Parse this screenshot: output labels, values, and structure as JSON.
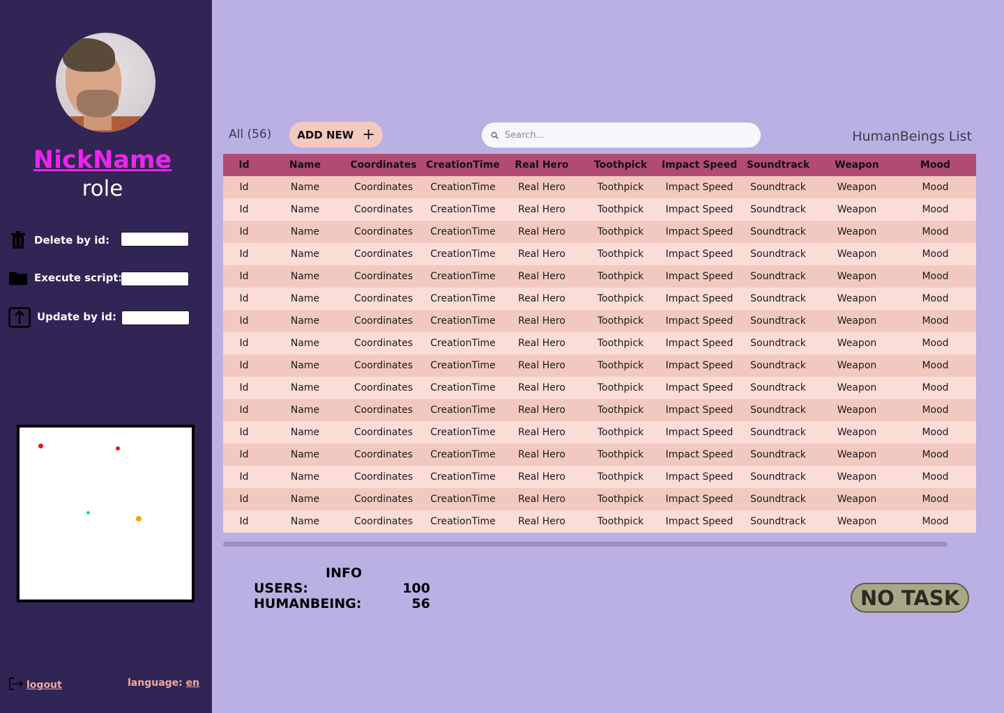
{
  "profile": {
    "nickname": "NickName",
    "role": "role"
  },
  "actions": [
    {
      "label": "Delete by id:",
      "icon": "trash-icon",
      "value": ""
    },
    {
      "label": "Execute script:",
      "icon": "folder-icon",
      "value": ""
    },
    {
      "label": "Update by id:",
      "icon": "upload-icon",
      "value": ""
    }
  ],
  "map": {
    "dots": [
      {
        "color": "#e8151c"
      },
      {
        "color": "#e8151c"
      },
      {
        "color": "#19e27a"
      },
      {
        "color": "#f6a20f"
      }
    ]
  },
  "footer": {
    "logout": "logout",
    "language_label": "language:",
    "language_value": "en"
  },
  "toolbar": {
    "all_label": "All (56)",
    "add_new": "ADD NEW",
    "add_icon": "plus-icon",
    "search_placeholder": "Search...",
    "list_title": "HumanBeings List"
  },
  "table": {
    "columns": [
      "Id",
      "Name",
      "Coordinates",
      "CreationTime",
      "Real Hero",
      "Toothpick",
      "Impact Speed",
      "Soundtrack",
      "Weapon",
      "Mood"
    ],
    "rows": [
      [
        "Id",
        "Name",
        "Coordinates",
        "CreationTime",
        "Real Hero",
        "Toothpick",
        "Impact Speed",
        "Soundtrack",
        "Weapon",
        "Mood"
      ],
      [
        "Id",
        "Name",
        "Coordinates",
        "CreationTime",
        "Real Hero",
        "Toothpick",
        "Impact Speed",
        "Soundtrack",
        "Weapon",
        "Mood"
      ],
      [
        "Id",
        "Name",
        "Coordinates",
        "CreationTime",
        "Real Hero",
        "Toothpick",
        "Impact Speed",
        "Soundtrack",
        "Weapon",
        "Mood"
      ],
      [
        "Id",
        "Name",
        "Coordinates",
        "CreationTime",
        "Real Hero",
        "Toothpick",
        "Impact Speed",
        "Soundtrack",
        "Weapon",
        "Mood"
      ],
      [
        "Id",
        "Name",
        "Coordinates",
        "CreationTime",
        "Real Hero",
        "Toothpick",
        "Impact Speed",
        "Soundtrack",
        "Weapon",
        "Mood"
      ],
      [
        "Id",
        "Name",
        "Coordinates",
        "CreationTime",
        "Real Hero",
        "Toothpick",
        "Impact Speed",
        "Soundtrack",
        "Weapon",
        "Mood"
      ],
      [
        "Id",
        "Name",
        "Coordinates",
        "CreationTime",
        "Real Hero",
        "Toothpick",
        "Impact Speed",
        "Soundtrack",
        "Weapon",
        "Mood"
      ],
      [
        "Id",
        "Name",
        "Coordinates",
        "CreationTime",
        "Real Hero",
        "Toothpick",
        "Impact Speed",
        "Soundtrack",
        "Weapon",
        "Mood"
      ],
      [
        "Id",
        "Name",
        "Coordinates",
        "CreationTime",
        "Real Hero",
        "Toothpick",
        "Impact Speed",
        "Soundtrack",
        "Weapon",
        "Mood"
      ],
      [
        "Id",
        "Name",
        "Coordinates",
        "CreationTime",
        "Real Hero",
        "Toothpick",
        "Impact Speed",
        "Soundtrack",
        "Weapon",
        "Mood"
      ],
      [
        "Id",
        "Name",
        "Coordinates",
        "CreationTime",
        "Real Hero",
        "Toothpick",
        "Impact Speed",
        "Soundtrack",
        "Weapon",
        "Mood"
      ],
      [
        "Id",
        "Name",
        "Coordinates",
        "CreationTime",
        "Real Hero",
        "Toothpick",
        "Impact Speed",
        "Soundtrack",
        "Weapon",
        "Mood"
      ],
      [
        "Id",
        "Name",
        "Coordinates",
        "CreationTime",
        "Real Hero",
        "Toothpick",
        "Impact Speed",
        "Soundtrack",
        "Weapon",
        "Mood"
      ],
      [
        "Id",
        "Name",
        "Coordinates",
        "CreationTime",
        "Real Hero",
        "Toothpick",
        "Impact Speed",
        "Soundtrack",
        "Weapon",
        "Mood"
      ],
      [
        "Id",
        "Name",
        "Coordinates",
        "CreationTime",
        "Real Hero",
        "Toothpick",
        "Impact Speed",
        "Soundtrack",
        "Weapon",
        "Mood"
      ],
      [
        "Id",
        "Name",
        "Coordinates",
        "CreationTime",
        "Real Hero",
        "Toothpick",
        "Impact Speed",
        "Soundtrack",
        "Weapon",
        "Mood"
      ]
    ]
  },
  "info": {
    "title": "INFO",
    "users_label": "USERS:",
    "users_value": "100",
    "humanbeing_label": "HUMANBEING:",
    "humanbeing_value": "56"
  },
  "task": {
    "label": "NO TASK"
  },
  "colors": {
    "sidebar": "#302554",
    "main_bg": "#bbb0e3",
    "header_row": "#b24b74",
    "row_even": "#f1c9c0",
    "row_odd": "#fbdcd6",
    "nickname": "#ee24ee",
    "link": "#f1a9a0"
  }
}
